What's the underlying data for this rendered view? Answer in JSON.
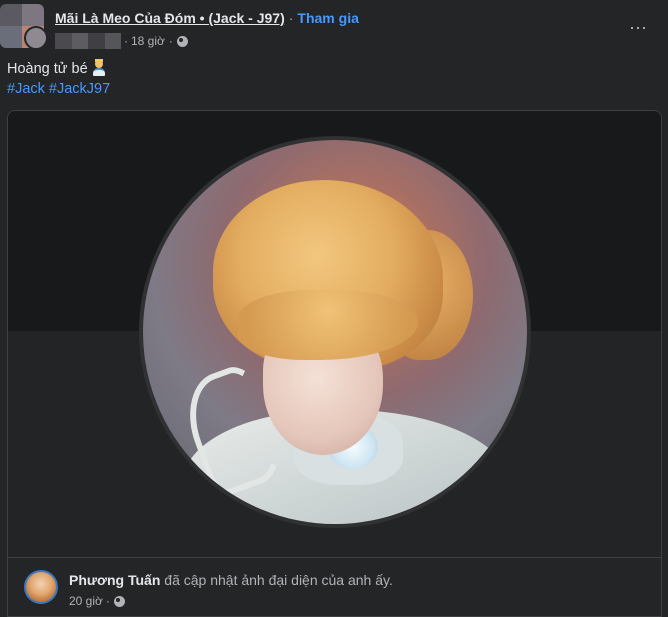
{
  "post": {
    "group_name": "Mãi Là Meo Của Đóm • (Jack - J97)",
    "separator": "·",
    "join_label": "Tham gia",
    "time": "18 giờ",
    "meta_separator": "·",
    "more_icon": "more-horizontal-icon",
    "more_label": "⋯"
  },
  "caption": {
    "text": "Hoàng tử bé",
    "emoji": "prince-emoji",
    "hashtags": [
      "#Jack",
      "#JackJ97"
    ]
  },
  "shared": {
    "author": "Phương Tuấn",
    "action": "đã cập nhật ảnh đại diện của anh ấy.",
    "time": "20 giờ",
    "meta_separator": "·",
    "privacy_icon": "globe-icon"
  },
  "colors": {
    "background": "#242526",
    "link": "#4599ff",
    "text_primary": "#e4e6eb",
    "text_secondary": "#b0b3b8"
  }
}
